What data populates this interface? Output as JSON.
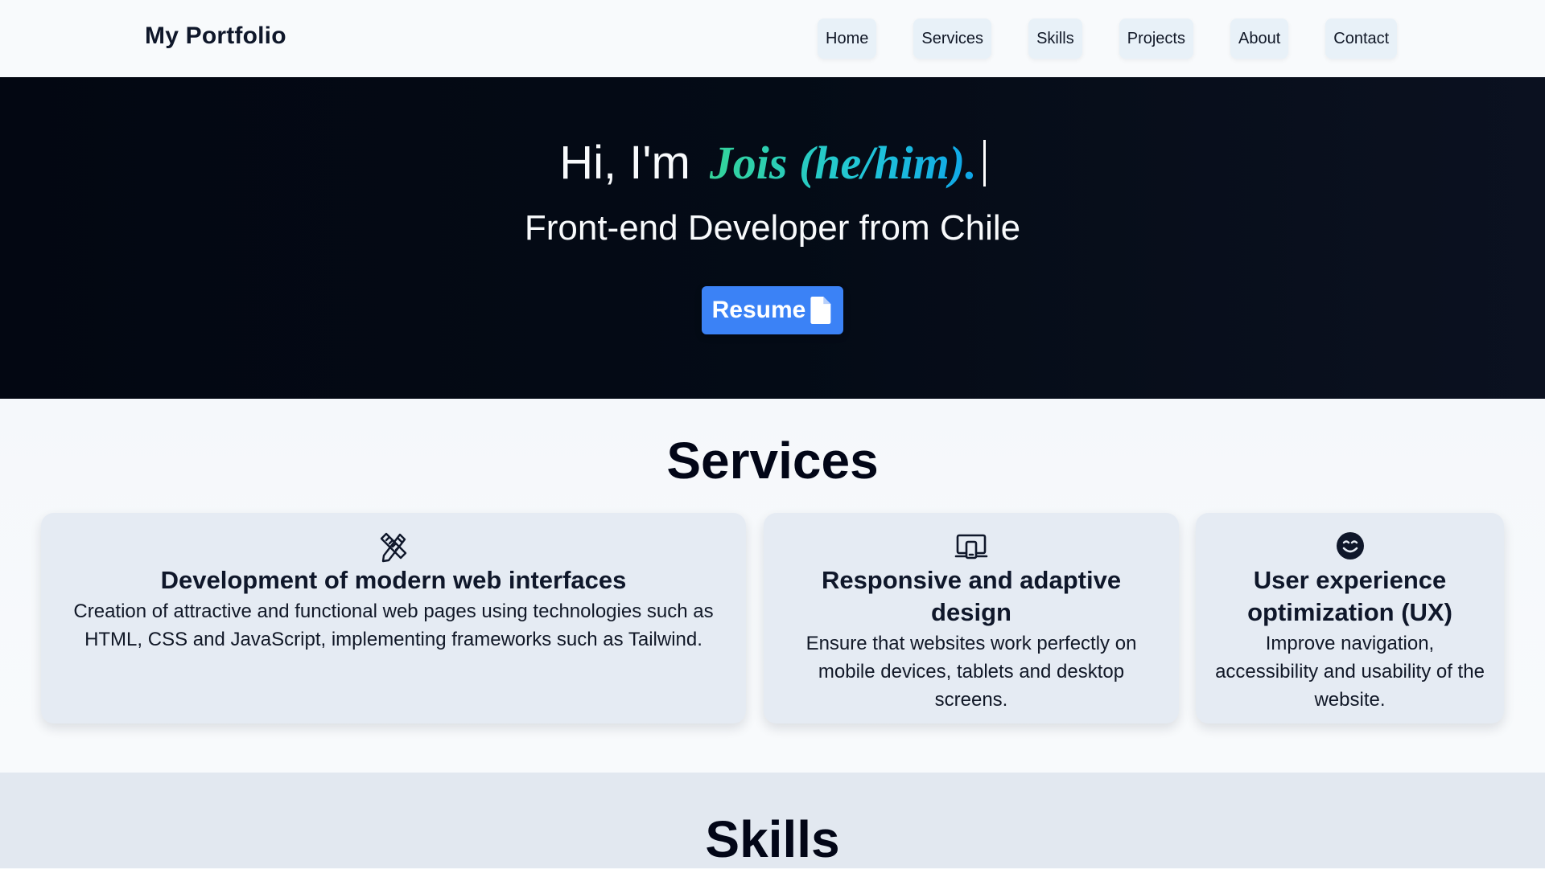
{
  "header": {
    "brand": "My Portfolio",
    "nav": [
      "Home",
      "Services",
      "Skills",
      "Projects",
      "About",
      "Contact"
    ]
  },
  "hero": {
    "greeting": "Hi, I'm",
    "name": "Jois (he/him).",
    "role": "Front-end Developer from Chile",
    "resume_label": "Resume",
    "resume_icon": "file-icon",
    "name_gradient": [
      "#34d399",
      "#0ea5e9"
    ]
  },
  "services": {
    "title": "Services",
    "cards": [
      {
        "icon": "pencil-ruler-icon",
        "title": "Development of modern web interfaces",
        "text": "Creation of attractive and functional web pages using technologies such as HTML, CSS and JavaScript, implementing frameworks such as Tailwind."
      },
      {
        "icon": "devices-icon",
        "title": "Responsive and adaptive design",
        "text": "Ensure that websites work perfectly on mobile devices, tablets and desktop screens."
      },
      {
        "icon": "smile-icon",
        "title": "User experience optimization (UX)",
        "text": "Improve navigation, accessibility and usability of the website."
      }
    ]
  },
  "skills": {
    "title": "Skills"
  },
  "colors": {
    "accent": "#3b82f6",
    "hero_bg": "#030712",
    "card_bg": "#e5ebf3"
  }
}
